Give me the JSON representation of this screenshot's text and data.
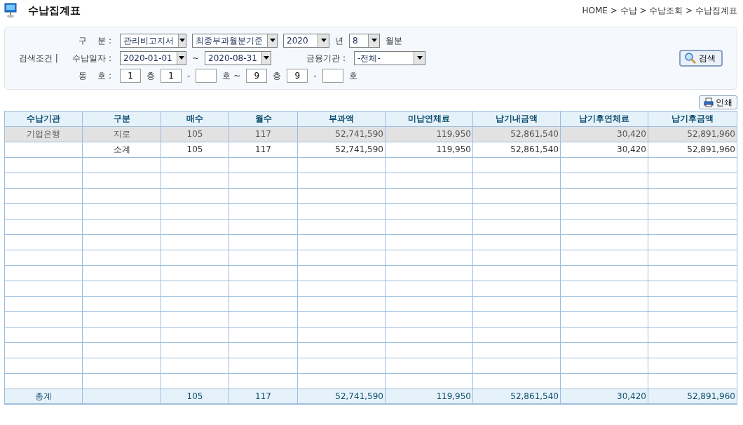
{
  "page_title": "수납집계표",
  "breadcrumb": "HOME > 수납 > 수납조회 >  수납집계표",
  "filter": {
    "caption": "검색조건 |",
    "rows": [
      {
        "label": "구    분 :",
        "items": [
          {
            "kind": "select",
            "value": "관리비고지서"
          },
          {
            "kind": "select",
            "value": "최종부과월분기준"
          },
          {
            "kind": "select",
            "value": "2020"
          },
          {
            "kind": "text",
            "text": "년"
          },
          {
            "kind": "select",
            "value": "8"
          },
          {
            "kind": "text",
            "text": "월분"
          }
        ]
      },
      {
        "label": "수납일자 :",
        "items": [
          {
            "kind": "select",
            "value": "2020-01-01"
          },
          {
            "kind": "text",
            "text": "~"
          },
          {
            "kind": "select",
            "value": "2020-08-31"
          },
          {
            "kind": "label",
            "text": "금융기관 :"
          },
          {
            "kind": "select",
            "value": "-전체-"
          }
        ]
      },
      {
        "label": "동    호 :",
        "items": [
          {
            "kind": "input",
            "value": "1"
          },
          {
            "kind": "text",
            "text": "층"
          },
          {
            "kind": "input",
            "value": "1"
          },
          {
            "kind": "text",
            "text": "-"
          },
          {
            "kind": "input"
          },
          {
            "kind": "text",
            "text": "호 ~"
          },
          {
            "kind": "input",
            "value": "9"
          },
          {
            "kind": "text",
            "text": "층"
          },
          {
            "kind": "input",
            "value": "9"
          },
          {
            "kind": "text",
            "text": "-"
          },
          {
            "kind": "input"
          },
          {
            "kind": "text",
            "text": "호"
          }
        ]
      }
    ],
    "search_button": "검색"
  },
  "print_button": "인쇄",
  "table": {
    "columns": [
      "수납기관",
      "구분",
      "매수",
      "월수",
      "부과액",
      "미납연체료",
      "납기내금액",
      "납기후연체료",
      "납기후금액"
    ],
    "rows": [
      {
        "selected": true,
        "cells": [
          "기업은행",
          "지로",
          "105",
          "117",
          "52,741,590",
          "119,950",
          "52,861,540",
          "30,420",
          "52,891,960"
        ]
      },
      {
        "selected": false,
        "cells": [
          null,
          "소계",
          "105",
          "117",
          "52,741,590",
          "119,950",
          "52,861,540",
          "30,420",
          "52,891,960"
        ]
      }
    ],
    "total": {
      "label": "총계",
      "figures": [
        "105",
        "117",
        "52,741,590",
        "119,950",
        "52,861,540",
        "30,420",
        "52,891,960"
      ]
    }
  }
}
